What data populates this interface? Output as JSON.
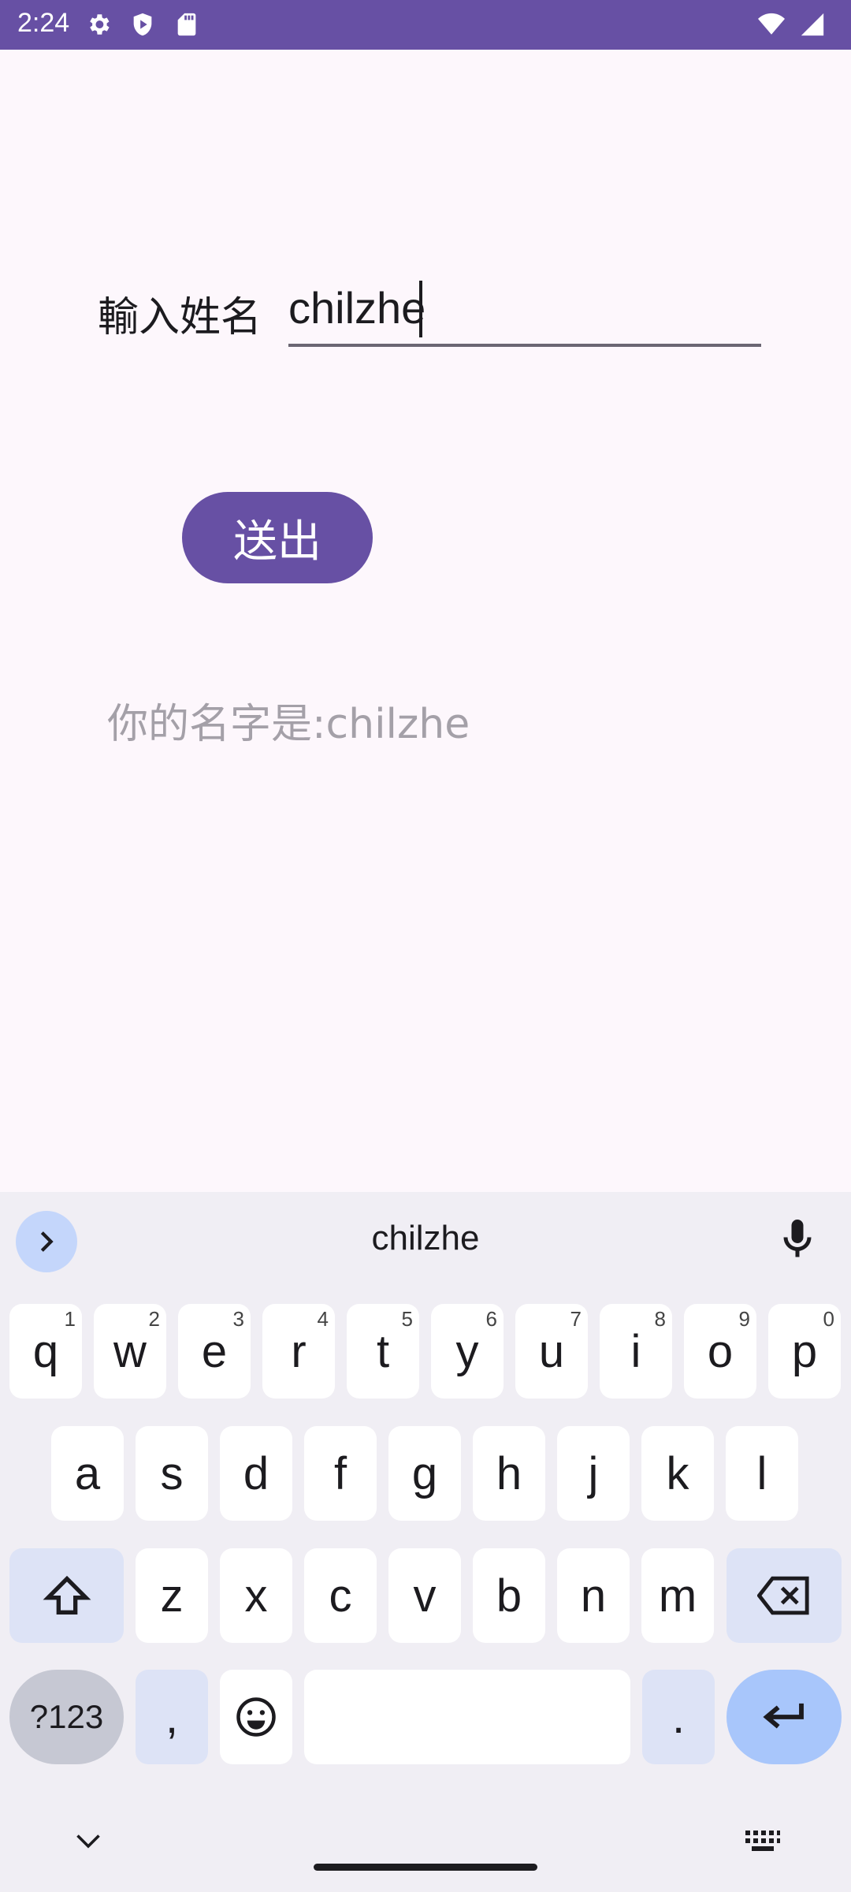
{
  "status_bar": {
    "time": "2:24",
    "left_icons": [
      "settings-icon",
      "shield-icon",
      "sd-card-icon"
    ],
    "right_icons": [
      "wifi-icon",
      "signal-icon"
    ]
  },
  "form": {
    "label": "輸入姓名",
    "input_value": "chilzhe",
    "submit_label": "送出",
    "result": "你的名字是:chilzhe"
  },
  "keyboard": {
    "suggestion": "chilzhe",
    "row1": [
      {
        "k": "q",
        "h": "1"
      },
      {
        "k": "w",
        "h": "2"
      },
      {
        "k": "e",
        "h": "3"
      },
      {
        "k": "r",
        "h": "4"
      },
      {
        "k": "t",
        "h": "5"
      },
      {
        "k": "y",
        "h": "6"
      },
      {
        "k": "u",
        "h": "7"
      },
      {
        "k": "i",
        "h": "8"
      },
      {
        "k": "o",
        "h": "9"
      },
      {
        "k": "p",
        "h": "0"
      }
    ],
    "row2": [
      "a",
      "s",
      "d",
      "f",
      "g",
      "h",
      "j",
      "k",
      "l"
    ],
    "row3": [
      "z",
      "x",
      "c",
      "v",
      "b",
      "n",
      "m"
    ],
    "symbols_label": "?123",
    "comma": ",",
    "period": "."
  },
  "colors": {
    "primary": "#6750a4",
    "background": "#fdf7fc",
    "keyboard_bg": "#f0eef4"
  }
}
